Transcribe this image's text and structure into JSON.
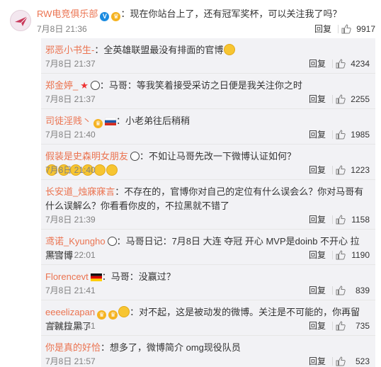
{
  "main_comment": {
    "username": "RW电竞俱乐部",
    "text": "：现在你站台上了，还有冠军奖杯，可以关注我了吗？",
    "time": "7月8日 21:36",
    "reply_label": "回复",
    "likes": "9917",
    "badges": [
      "verified-v-icon",
      "vip-crown-icon"
    ]
  },
  "replies": [
    {
      "username": "邪恶小书生-",
      "text": "：全英雄联盟最没有排面的官博",
      "time": "7月8日 21:37",
      "reply_label": "回复",
      "likes": "4234"
    },
    {
      "username": "郑金婷_",
      "text": "：马哥：等我笑着接受采访之日便是我关注你之时",
      "time": "7月8日 21:37",
      "reply_label": "回复",
      "likes": "2255"
    },
    {
      "username": "司徒淫贱丶",
      "text": "：小老弟往后稍稍",
      "time": "7月8日 21:40",
      "reply_label": "回复",
      "likes": "1985"
    },
    {
      "username": "假装是史森明女朋友",
      "text": "：不如让马哥先改一下微博认证如何？",
      "time": "7月8日 21:40",
      "reply_label": "回复",
      "likes": "1223"
    },
    {
      "username": "长安道_烛寐寐言",
      "text": "：不存在的，官博你对自己的定位有什么误会么？你对马哥有什么误解么？你看看你皮的，不拉黑就不错了",
      "time": "7月8日 21:39",
      "reply_label": "回复",
      "likes": "1158"
    },
    {
      "username": "鸢诺_Kyungho",
      "text": "：马哥日记：7月8日 大连 夺冠 开心 MVP是doinb 不开心 拉黑官博",
      "time": "7月8日 22:01",
      "reply_label": "回复",
      "likes": "1190"
    },
    {
      "username": "Florencevt",
      "text": "：马哥：没赢过？",
      "time": "7月8日 21:41",
      "reply_label": "回复",
      "likes": "839"
    },
    {
      "username": "eeeelizapan",
      "text": "：对不起，这是被动发的微博。关注是不可能的，你再留言就拉黑了",
      "time": "7月8日 21:41",
      "reply_label": "回复",
      "likes": "735"
    },
    {
      "username": "你是真的好恰",
      "text": "：想多了，微博简介 omg现役队员",
      "time": "7月8日 21:57",
      "reply_label": "回复",
      "likes": "523"
    }
  ],
  "colors": {
    "username": "#eb7350",
    "reply_bg": "#f2f2f5",
    "timestamp": "#808080"
  }
}
